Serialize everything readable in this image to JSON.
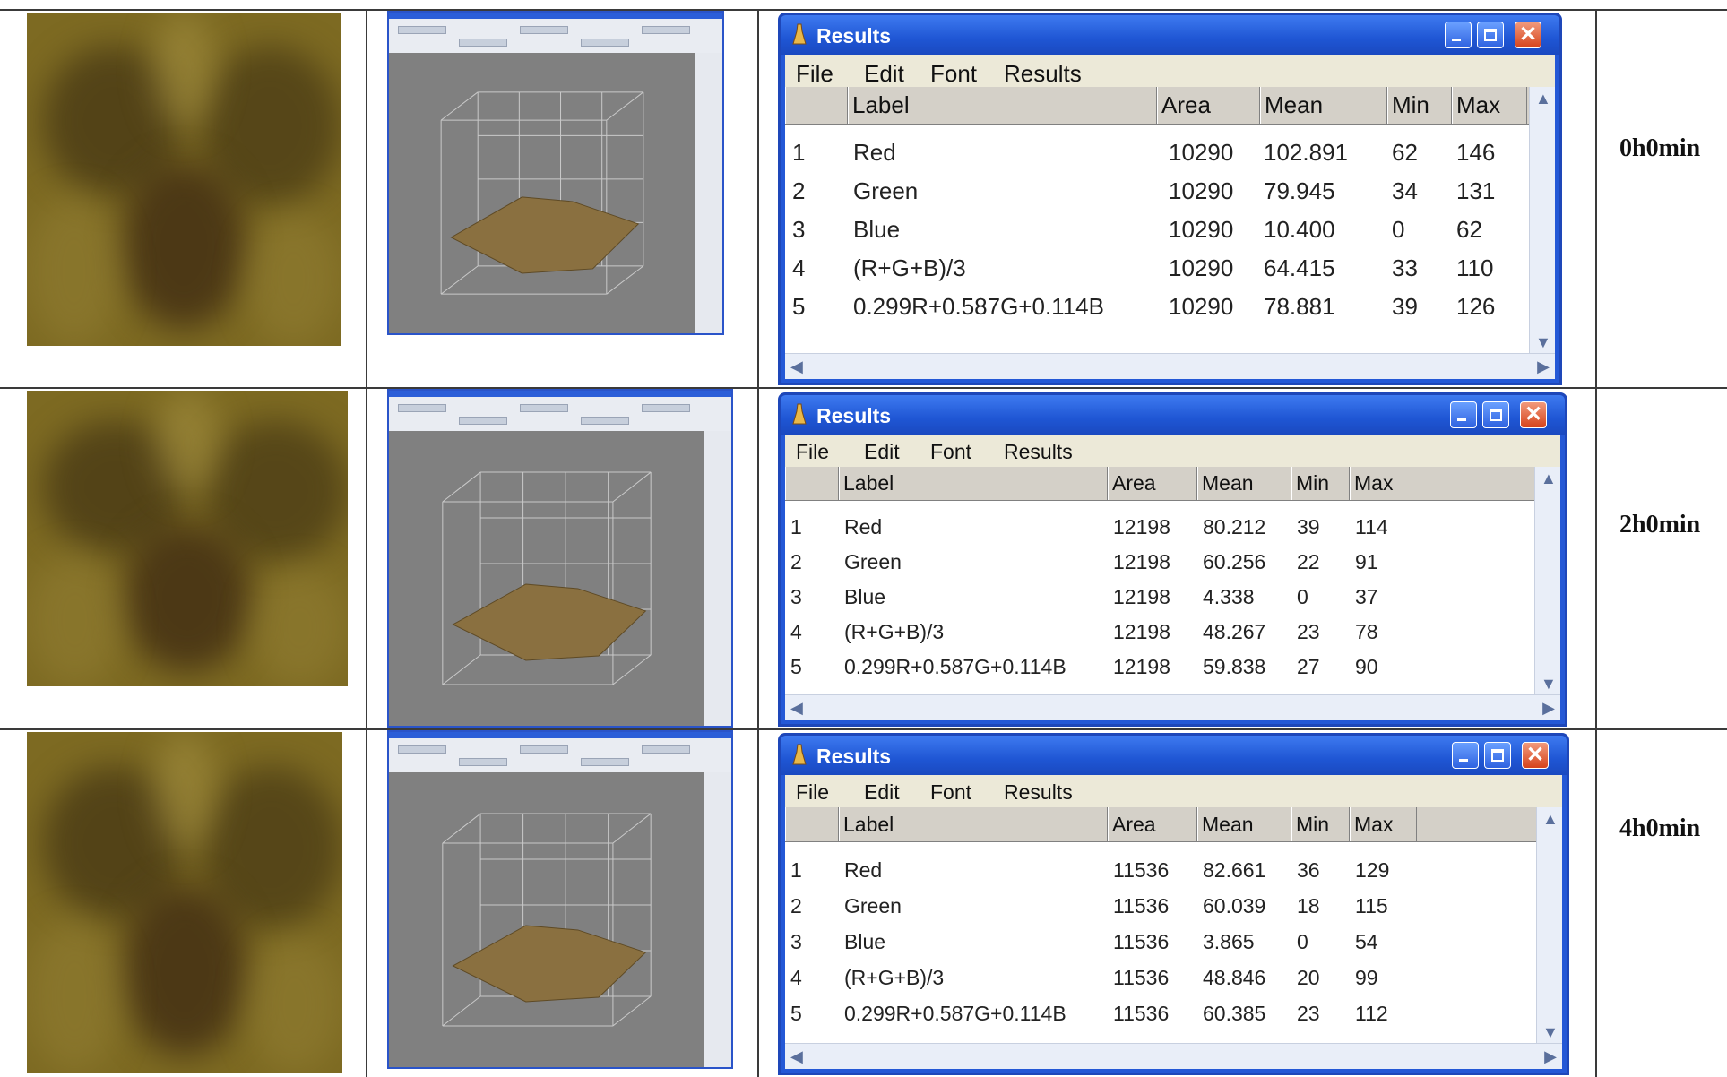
{
  "rows": [
    {
      "time_label": "0h0min",
      "results": {
        "title": "Results",
        "menu": [
          "File",
          "Edit",
          "Font",
          "Results"
        ],
        "headers": [
          "Label",
          "Area",
          "Mean",
          "Min",
          "Max"
        ],
        "rows": [
          [
            "1",
            "Red",
            "10290",
            "102.891",
            "62",
            "146"
          ],
          [
            "2",
            "Green",
            "10290",
            "79.945",
            "34",
            "131"
          ],
          [
            "3",
            "Blue",
            "10290",
            "10.400",
            "0",
            "62"
          ],
          [
            "4",
            "(R+G+B)/3",
            "10290",
            "64.415",
            "33",
            "110"
          ],
          [
            "5",
            "0.299R+0.587G+0.114B",
            "10290",
            "78.881",
            "39",
            "126"
          ]
        ]
      }
    },
    {
      "time_label": "2h0min",
      "results": {
        "title": "Results",
        "menu": [
          "File",
          "Edit",
          "Font",
          "Results"
        ],
        "headers": [
          "Label",
          "Area",
          "Mean",
          "Min",
          "Max"
        ],
        "rows": [
          [
            "1",
            "Red",
            "12198",
            "80.212",
            "39",
            "114"
          ],
          [
            "2",
            "Green",
            "12198",
            "60.256",
            "22",
            "91"
          ],
          [
            "3",
            "Blue",
            "12198",
            "4.338",
            "0",
            "37"
          ],
          [
            "4",
            "(R+G+B)/3",
            "12198",
            "48.267",
            "23",
            "78"
          ],
          [
            "5",
            "0.299R+0.587G+0.114B",
            "12198",
            "59.838",
            "27",
            "90"
          ]
        ]
      }
    },
    {
      "time_label": "4h0min",
      "results": {
        "title": "Results",
        "menu": [
          "File",
          "Edit",
          "Font",
          "Results"
        ],
        "headers": [
          "Label",
          "Area",
          "Mean",
          "Min",
          "Max"
        ],
        "rows": [
          [
            "1",
            "Red",
            "11536",
            "82.661",
            "36",
            "129"
          ],
          [
            "2",
            "Green",
            "11536",
            "60.039",
            "18",
            "115"
          ],
          [
            "3",
            "Blue",
            "11536",
            "3.865",
            "0",
            "54"
          ],
          [
            "4",
            "(R+G+B)/3",
            "11536",
            "48.846",
            "20",
            "99"
          ],
          [
            "5",
            "0.299R+0.587G+0.114B",
            "11536",
            "60.385",
            "23",
            "112"
          ]
        ]
      }
    }
  ],
  "colors": {
    "titlebar": "#2458d6",
    "sample_base": "#7d6a22",
    "plot_canvas": "#808080"
  }
}
